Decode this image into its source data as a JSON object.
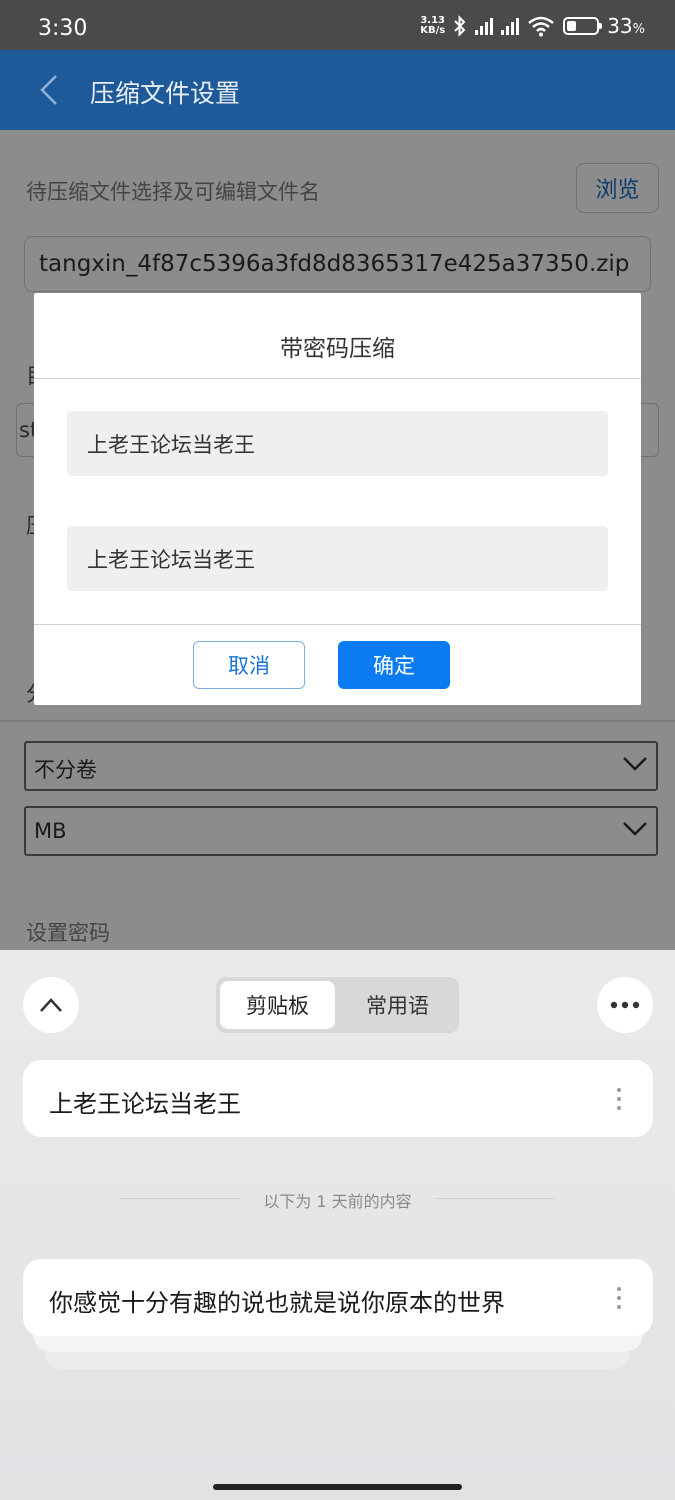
{
  "status_bar": {
    "time": "3:30",
    "speed_value": "3.13",
    "speed_unit": "KB/s",
    "battery_percent": "33",
    "battery_level": 0.33
  },
  "app": {
    "title": "压缩文件设置",
    "file_label": "待压缩文件选择及可编辑文件名",
    "browse_label": "浏览",
    "file_name": "tangxin_4f87c5396a3fd8d8365317e425a37350.zip",
    "volume_select": "不分卷",
    "unit_select": "MB",
    "password_label": "设置密码"
  },
  "dialog": {
    "title": "带密码压缩",
    "password_value": "上老王论坛当老王",
    "confirm_value": "上老王论坛当老王",
    "cancel_label": "取消",
    "ok_label": "确定"
  },
  "keyboard": {
    "tab_clipboard": "剪贴板",
    "tab_phrases": "常用语",
    "clip_items": [
      "上老王论坛当老王",
      "你感觉十分有趣的说也就是说你原本的世界"
    ],
    "separator": "以下为 1 天前的内容"
  },
  "colors": {
    "app_bar": "#1e5a9a",
    "primary_button": "#0a7bf0"
  }
}
